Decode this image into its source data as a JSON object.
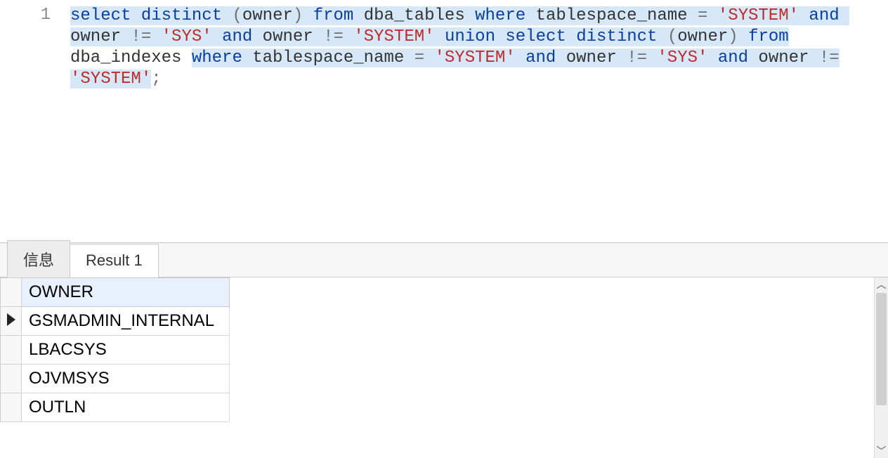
{
  "editor": {
    "line_number": "1",
    "tokens": [
      {
        "t": "select",
        "c": "kw",
        "sel": true
      },
      {
        "t": " ",
        "c": "txt",
        "sel": true
      },
      {
        "t": "distinct",
        "c": "kw",
        "sel": true
      },
      {
        "t": " ",
        "c": "txt",
        "sel": true
      },
      {
        "t": "(",
        "c": "op",
        "sel": true
      },
      {
        "t": "owner",
        "c": "txt",
        "sel": true
      },
      {
        "t": ")",
        "c": "op",
        "sel": true
      },
      {
        "t": " ",
        "c": "txt",
        "sel": true
      },
      {
        "t": "from",
        "c": "kw",
        "sel": true
      },
      {
        "t": " dba_tables ",
        "c": "txt",
        "sel": true
      },
      {
        "t": "where",
        "c": "kw",
        "sel": true
      },
      {
        "t": " tablespace_name ",
        "c": "txt",
        "sel": true
      },
      {
        "t": "=",
        "c": "op",
        "sel": true
      },
      {
        "t": " ",
        "c": "txt",
        "sel": true
      },
      {
        "t": "'SYSTEM'",
        "c": "str",
        "sel": true
      },
      {
        "t": " ",
        "c": "txt",
        "sel": true
      },
      {
        "t": "and",
        "c": "kw",
        "sel": true
      },
      {
        "t": " owner ",
        "c": "txt",
        "sel": true
      },
      {
        "t": "!=",
        "c": "op",
        "sel": true
      },
      {
        "t": " ",
        "c": "txt",
        "sel": true
      },
      {
        "t": "'SYS'",
        "c": "str",
        "sel": true
      },
      {
        "t": " ",
        "c": "txt",
        "sel": true
      },
      {
        "t": "and",
        "c": "kw",
        "sel": true
      },
      {
        "t": " owner ",
        "c": "txt",
        "sel": true
      },
      {
        "t": "!=",
        "c": "op",
        "sel": true
      },
      {
        "t": " ",
        "c": "txt",
        "sel": true
      },
      {
        "t": "'SYSTEM'",
        "c": "str",
        "sel": true
      },
      {
        "t": " ",
        "c": "txt",
        "sel": true
      },
      {
        "t": "union",
        "c": "kw",
        "sel": true
      },
      {
        "t": " ",
        "c": "txt",
        "sel": true
      },
      {
        "t": "select",
        "c": "kw",
        "sel": true
      },
      {
        "t": " ",
        "c": "txt",
        "sel": true
      },
      {
        "t": "distinct",
        "c": "kw",
        "sel": true
      },
      {
        "t": " ",
        "c": "txt",
        "sel": true
      },
      {
        "t": "(",
        "c": "op",
        "sel": true
      },
      {
        "t": "owner",
        "c": "txt",
        "sel": true
      },
      {
        "t": ")",
        "c": "op",
        "sel": true
      },
      {
        "t": " ",
        "c": "txt",
        "sel": true
      },
      {
        "t": "from",
        "c": "kw",
        "sel": true
      },
      {
        "t": " dba_indexes ",
        "c": "txt",
        "sel": false
      },
      {
        "t": "where",
        "c": "kw",
        "sel": true
      },
      {
        "t": " tablespace_name ",
        "c": "txt",
        "sel": true
      },
      {
        "t": "=",
        "c": "op",
        "sel": true
      },
      {
        "t": " ",
        "c": "txt",
        "sel": true
      },
      {
        "t": "'SYSTEM'",
        "c": "str",
        "sel": true
      },
      {
        "t": " ",
        "c": "txt",
        "sel": true
      },
      {
        "t": "and",
        "c": "kw",
        "sel": true
      },
      {
        "t": " owner ",
        "c": "txt",
        "sel": true
      },
      {
        "t": "!=",
        "c": "op",
        "sel": true
      },
      {
        "t": " ",
        "c": "txt",
        "sel": true
      },
      {
        "t": "'SYS'",
        "c": "str",
        "sel": true
      },
      {
        "t": " ",
        "c": "txt",
        "sel": true
      },
      {
        "t": "and",
        "c": "kw",
        "sel": true
      },
      {
        "t": " owner ",
        "c": "txt",
        "sel": true
      },
      {
        "t": "!=",
        "c": "op",
        "sel": true
      },
      {
        "t": " ",
        "c": "txt",
        "sel": false
      },
      {
        "t": "'SYSTEM'",
        "c": "str",
        "sel": true
      },
      {
        "t": ";",
        "c": "op",
        "sel": false
      }
    ]
  },
  "tabs": {
    "info_label": "信息",
    "result_label": "Result 1"
  },
  "results": {
    "column_header": "OWNER",
    "rows": [
      {
        "value": "GSMADMIN_INTERNAL",
        "current": true
      },
      {
        "value": "LBACSYS",
        "current": false
      },
      {
        "value": "OJVMSYS",
        "current": false
      },
      {
        "value": "OUTLN",
        "current": false
      }
    ]
  },
  "scroll": {
    "up_glyph": "︿",
    "down_glyph": "﹀"
  }
}
